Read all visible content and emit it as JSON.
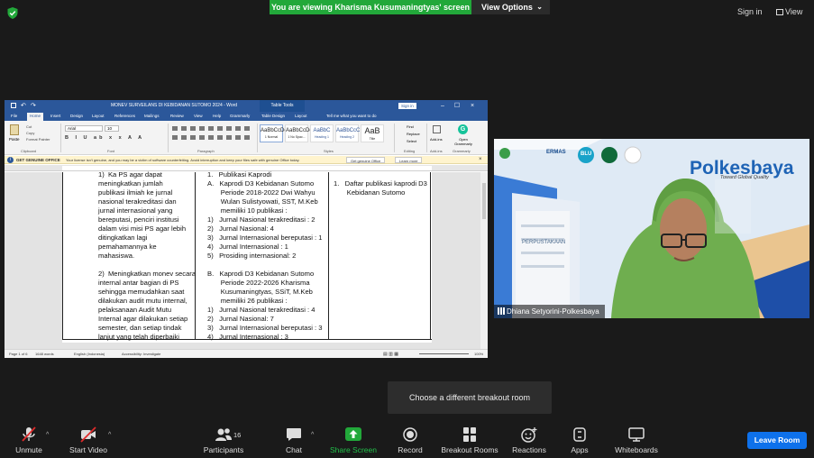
{
  "zoom": {
    "banner": "You are viewing Kharisma Kusumaningtyas' screen",
    "view_options": "View Options",
    "sign_in": "Sign in",
    "view": "View",
    "tooltip": "Choose a different breakout room",
    "leave_room": "Leave Room",
    "participants_count": "16",
    "colors": {
      "banner": "#22a83a",
      "leave": "#0e71eb",
      "share": "#22a83a"
    }
  },
  "toolbar": [
    {
      "name": "unmute",
      "label": "Unmute",
      "icon": "mic-muted-icon"
    },
    {
      "name": "start-video",
      "label": "Start Video",
      "icon": "video-off-icon"
    },
    {
      "name": "participants",
      "label": "Participants",
      "icon": "participants-icon"
    },
    {
      "name": "chat",
      "label": "Chat",
      "icon": "chat-icon"
    },
    {
      "name": "share-screen",
      "label": "Share Screen",
      "icon": "share-screen-icon"
    },
    {
      "name": "record",
      "label": "Record",
      "icon": "record-icon"
    },
    {
      "name": "breakout-rooms",
      "label": "Breakout Rooms",
      "icon": "breakout-rooms-icon"
    },
    {
      "name": "reactions",
      "label": "Reactions",
      "icon": "reactions-icon"
    },
    {
      "name": "apps",
      "label": "Apps",
      "icon": "apps-icon"
    },
    {
      "name": "whiteboards",
      "label": "Whiteboards",
      "icon": "whiteboard-icon"
    }
  ],
  "video": {
    "participant_name": "Dhiana Setyorini-Polkesbaya",
    "logo_text": "Polkesbaya",
    "logo_tagline": "Toward Global Quality",
    "building_sign": "PERPUSTAKAAN",
    "badges": [
      "ERMAS",
      "BLU"
    ]
  },
  "word": {
    "title": "MONEV SURVEILANS DI KEBIDANAN SUTOMO 2024 - Word",
    "table_tools": "Table Tools",
    "sign_in": "Sign in",
    "tabs": [
      "File",
      "Home",
      "Insert",
      "Design",
      "Layout",
      "References",
      "Mailings",
      "Review",
      "View",
      "Help",
      "Grammarly",
      "Table Design",
      "Layout",
      "Tell me what you want to do"
    ],
    "font": "Arial",
    "font_size": "10",
    "styles": [
      {
        "sample": "AaBbCcDc",
        "name": "1 Normal"
      },
      {
        "sample": "AaBbCcDc",
        "name": "1 No Spac..."
      },
      {
        "sample": "AaBbC",
        "name": "Heading 1"
      },
      {
        "sample": "AaBbCcC",
        "name": "Heading 2"
      },
      {
        "sample": "AaB",
        "name": "Title"
      }
    ],
    "ribbon_groups": [
      "Clipboard",
      "Font",
      "Paragraph",
      "Styles",
      "Editing",
      "Add-ins",
      "Grammarly"
    ],
    "clipboard": {
      "paste": "Paste",
      "cut": "Cut",
      "copy": "Copy",
      "format_painter": "Format Painter"
    },
    "editing": {
      "find": "Find",
      "replace": "Replace",
      "select": "Select"
    },
    "addins": "Add-ins",
    "grammarly": "Open Grammarly",
    "warning": {
      "title": "GET GENUINE OFFICE",
      "text": "Your license isn't genuine, and you may be a victim of software counterfeiting. Avoid interruption and keep your files safe with genuine Office today.",
      "btn1": "Get genuine Office",
      "btn2": "Learn more"
    },
    "status": {
      "page": "Page 1 of 6",
      "words": "1648 words",
      "lang": "English (Indonesia)",
      "accessibility": "Accessibility: Investigate",
      "zoom": "100%"
    },
    "doc": {
      "col1": [
        "1)  Ka PS agar dapat",
        "meningkatkan jumlah",
        "publikasi ilmiah ke jurnal",
        "nasional terakreditasi dan",
        "jurnal internasional yang",
        "bereputasi, penciri institusi",
        "dalam visi misi PS agar lebih",
        "ditingkatkan lagi",
        "pemahamannya ke",
        "mahasiswa.",
        "",
        "2)  Meningkatkan monev secara",
        "internal antar bagian di PS",
        "sehingga memudahkan saat",
        "dilakukan audit mutu internal,",
        "pelaksanaan Audit Mutu",
        "Internal agar dilakukan setiap",
        "semester, dan setiap tindak",
        "lanjut yang telah diperbaiki"
      ],
      "col2": [
        "1.   Publikasi Kaprodi",
        "A.   Kaprodi D3 Kebidanan Sutomo",
        "       Periode 2018-2022 Dwi Wahyu",
        "       Wulan Sulistyowati, SST, M.Keb",
        "       memiliki 10 publikasi :",
        "1)   Jurnal Nasional terakreditasi : 2",
        "2)   Jurnal Nasional: 4",
        "3)   Jurnal Internasional bereputasi : 1",
        "4)   Jurnal Internasional : 1",
        "5)   Prosiding internasional: 2",
        "",
        "B.   Kaprodi D3 Kebidanan Sutomo",
        "       Periode 2022-2026 Kharisma",
        "       Kusumaningtyas, SSiT, M.Keb",
        "       memiliki 26 publikasi :",
        "1)   Jurnal Nasional terakreditasi : 4",
        "2)   Jurnal Nasional: 7",
        "3)   Jurnal Internasional bereputasi : 3",
        "4)   Jurnal Internasional : 3"
      ],
      "col3": [
        "1.   Daftar publikasi kaprodi D3",
        "       Kebidanan Sutomo"
      ]
    }
  }
}
